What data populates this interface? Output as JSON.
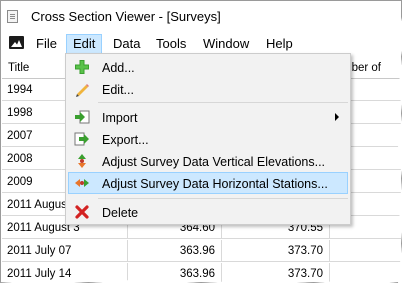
{
  "window": {
    "title": "Cross Section Viewer - [Surveys]"
  },
  "menubar": {
    "items": [
      "File",
      "Edit",
      "Data",
      "Tools",
      "Window",
      "Help"
    ],
    "active": "Edit"
  },
  "table": {
    "headers": [
      "Title",
      "",
      "",
      "mber of"
    ],
    "rows": [
      [
        "1994",
        "",
        "",
        ""
      ],
      [
        "1998",
        "",
        "",
        ""
      ],
      [
        "2007",
        "",
        "",
        ""
      ],
      [
        "2008",
        "",
        "",
        ""
      ],
      [
        "2009",
        "",
        "",
        ""
      ],
      [
        "2011 August",
        "",
        "",
        ""
      ],
      [
        "2011 August 3",
        "364.60",
        "370.55",
        ""
      ],
      [
        "2011 July 07",
        "363.96",
        "373.70",
        ""
      ],
      [
        "2011 July 14",
        "363.96",
        "373.70",
        ""
      ]
    ]
  },
  "edit_menu": {
    "items": [
      {
        "label": "Add...",
        "icon": "plus-icon"
      },
      {
        "label": "Edit...",
        "icon": "pencil-icon"
      },
      {
        "label": "Import",
        "icon": "import-icon",
        "submenu": true
      },
      {
        "label": "Export...",
        "icon": "export-icon"
      },
      {
        "label": "Adjust Survey Data Vertical Elevations...",
        "icon": "adjust-vertical-icon"
      },
      {
        "label": "Adjust Survey Data Horizontal Stations...",
        "icon": "adjust-horizontal-icon",
        "highlighted": true
      },
      {
        "label": "Delete",
        "icon": "delete-x-icon"
      }
    ]
  },
  "colors": {
    "highlight": "#cce8ff",
    "highlight_border": "#99d1ff",
    "menu_bg": "#f2f2f2",
    "add_green": "#3a9f2f",
    "delete_red": "#d32222"
  }
}
